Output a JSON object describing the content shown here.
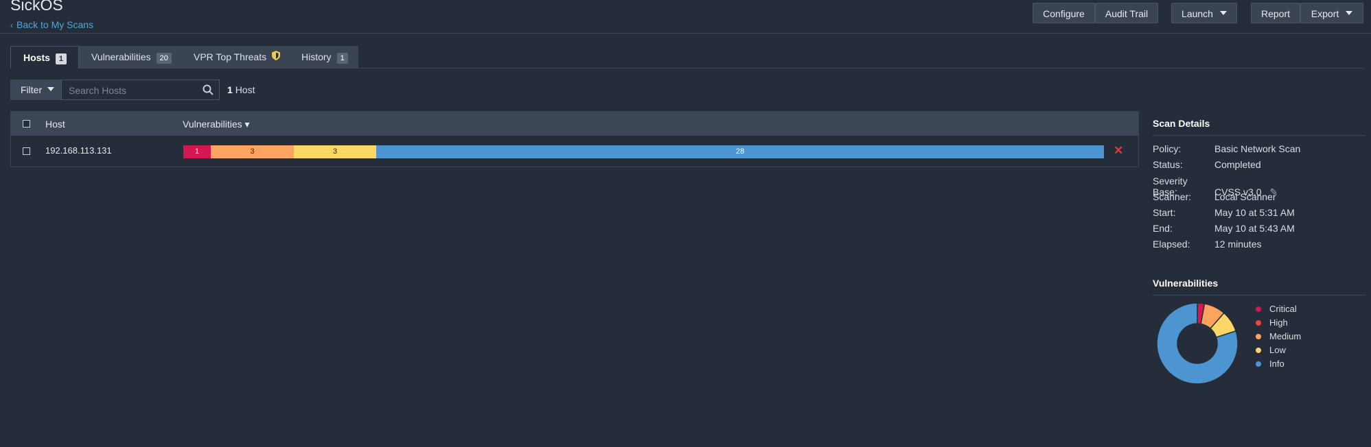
{
  "header": {
    "title": "SickOS",
    "back_link": "Back to My Scans",
    "buttons": {
      "configure": "Configure",
      "audit_trail": "Audit Trail",
      "launch": "Launch",
      "report": "Report",
      "export": "Export"
    }
  },
  "tabs": [
    {
      "label": "Hosts",
      "count": "1"
    },
    {
      "label": "Vulnerabilities",
      "count": "20"
    },
    {
      "label": "VPR Top Threats",
      "icon": "shield-icon"
    },
    {
      "label": "History",
      "count": "1"
    }
  ],
  "toolbar": {
    "filter_label": "Filter",
    "search_placeholder": "Search Hosts",
    "host_count_num": "1",
    "host_count_label": "Host"
  },
  "table": {
    "headers": {
      "host": "Host",
      "vulnerabilities": "Vulnerabilities ▾"
    },
    "rows": [
      {
        "host": "192.168.113.131",
        "critical": "1",
        "high": "3",
        "medium": "3",
        "info": "28"
      }
    ]
  },
  "scan_details": {
    "title": "Scan Details",
    "policy_label": "Policy:",
    "policy": "Basic Network Scan",
    "status_label": "Status:",
    "status": "Completed",
    "severity_label": "Severity Base:",
    "severity": "CVSS v3.0",
    "scanner_label": "Scanner:",
    "scanner": "Local Scanner",
    "start_label": "Start:",
    "start": "May 10 at 5:31 AM",
    "end_label": "End:",
    "end": "May 10 at 5:43 AM",
    "elapsed_label": "Elapsed:",
    "elapsed": "12 minutes"
  },
  "vuln_summary": {
    "title": "Vulnerabilities",
    "legend": {
      "critical": "Critical",
      "high": "High",
      "medium": "Medium",
      "low": "Low",
      "info": "Info"
    }
  },
  "colors": {
    "critical": "#d4184f",
    "high": "#ee4245",
    "medium": "#fda460",
    "low": "#fdd765",
    "info": "#4c95d0",
    "accent": "#4fa6d9"
  },
  "chart_data": {
    "type": "pie",
    "categories": [
      "Critical",
      "High",
      "Medium",
      "Low",
      "Info"
    ],
    "values": [
      1,
      0,
      3,
      3,
      28
    ]
  }
}
